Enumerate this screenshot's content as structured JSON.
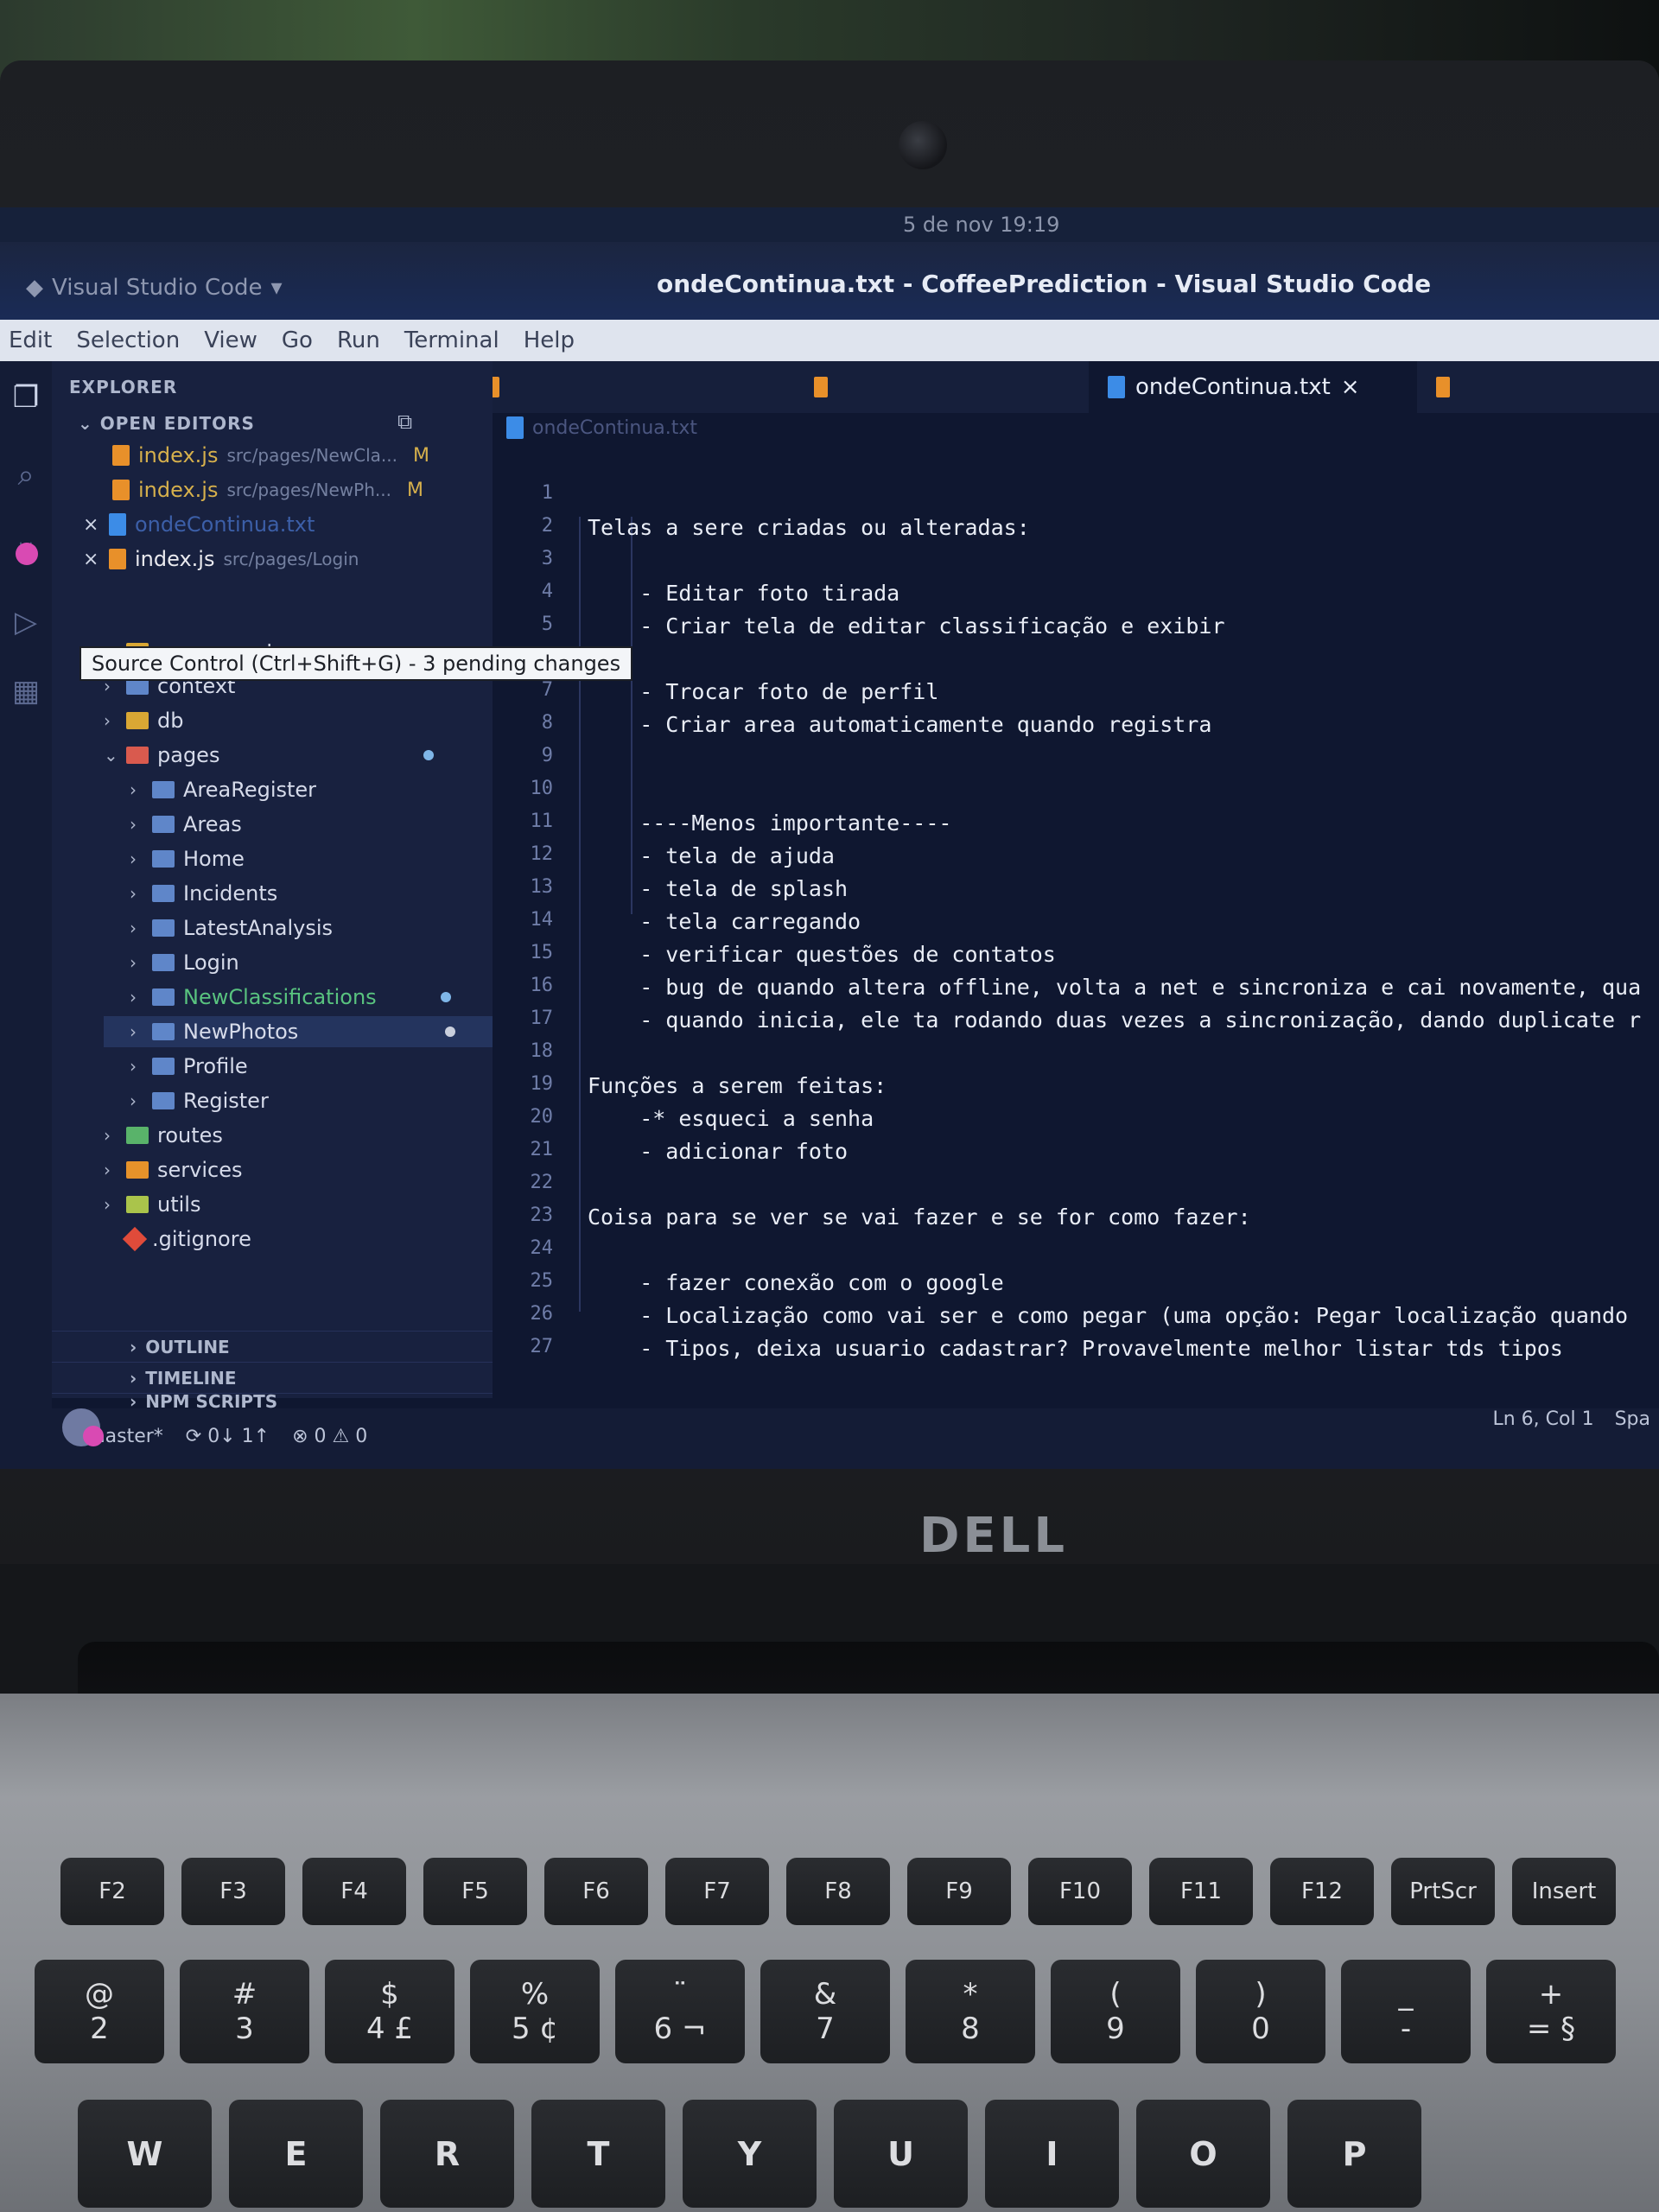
{
  "system": {
    "clock": "5 de nov  19:19"
  },
  "window": {
    "app_menu": "Visual Studio Code",
    "title": "ondeContinua.txt - CoffeePrediction - Visual Studio Code"
  },
  "menu": [
    "Edit",
    "Selection",
    "View",
    "Go",
    "Run",
    "Terminal",
    "Help"
  ],
  "tabs": [
    {
      "label": "ondeContinua.txt",
      "close": "×"
    }
  ],
  "breadcrumb": "ondeContinua.txt",
  "explorer": {
    "title": "EXPLORER",
    "open_editors_title": "OPEN EDITORS",
    "open_editors": [
      {
        "name": "index.js",
        "path": "src/pages/NewCla...",
        "status": "M"
      },
      {
        "name": "index.js",
        "path": "src/pages/NewPh...",
        "status": "M"
      },
      {
        "name": "ondeContinua.txt",
        "path": "",
        "status": ""
      },
      {
        "name": "index.js",
        "path": "src/pages/Login",
        "status": ""
      }
    ],
    "tooltip": "Source Control (Ctrl+Shift+G) - 3 pending changes",
    "tree": [
      {
        "label": "components",
        "depth": 1,
        "color": "yellow"
      },
      {
        "label": "context",
        "depth": 1,
        "color": "blue"
      },
      {
        "label": "db",
        "depth": 1,
        "color": "yellow"
      },
      {
        "label": "pages",
        "depth": 1,
        "color": "red",
        "open": true
      },
      {
        "label": "AreaRegister",
        "depth": 2,
        "color": "blue"
      },
      {
        "label": "Areas",
        "depth": 2,
        "color": "blue"
      },
      {
        "label": "Home",
        "depth": 2,
        "color": "blue"
      },
      {
        "label": "Incidents",
        "depth": 2,
        "color": "blue"
      },
      {
        "label": "LatestAnalysis",
        "depth": 2,
        "color": "blue"
      },
      {
        "label": "Login",
        "depth": 2,
        "color": "blue"
      },
      {
        "label": "NewClassifications",
        "depth": 2,
        "color": "blue",
        "modified": true
      },
      {
        "label": "NewPhotos",
        "depth": 2,
        "color": "blue",
        "selected": true
      },
      {
        "label": "Profile",
        "depth": 2,
        "color": "blue"
      },
      {
        "label": "Register",
        "depth": 2,
        "color": "blue"
      },
      {
        "label": "routes",
        "depth": 1,
        "color": "green"
      },
      {
        "label": "services",
        "depth": 1,
        "color": "orange"
      },
      {
        "label": "utils",
        "depth": 1,
        "color": "lime"
      },
      {
        "label": ".gitignore",
        "depth": 1,
        "color": "git"
      }
    ],
    "panels": [
      "OUTLINE",
      "TIMELINE",
      "NPM SCRIPTS"
    ]
  },
  "editor": {
    "lines": [
      {
        "n": "1",
        "text": ""
      },
      {
        "n": "2",
        "text": "Telas a sere criadas ou alteradas:"
      },
      {
        "n": "3",
        "text": ""
      },
      {
        "n": "4",
        "text": "    - Editar foto tirada"
      },
      {
        "n": "5",
        "text": "    - Criar tela de editar classificação e exibir"
      },
      {
        "n": "6",
        "text": ""
      },
      {
        "n": "7",
        "text": "    - Trocar foto de perfil"
      },
      {
        "n": "8",
        "text": "    - Criar area automaticamente quando registra"
      },
      {
        "n": "9",
        "text": ""
      },
      {
        "n": "10",
        "text": ""
      },
      {
        "n": "11",
        "text": "    ----Menos importante----"
      },
      {
        "n": "12",
        "text": "    - tela de ajuda"
      },
      {
        "n": "13",
        "text": "    - tela de splash"
      },
      {
        "n": "14",
        "text": "    - tela carregando"
      },
      {
        "n": "15",
        "text": "    - verificar questões de contatos"
      },
      {
        "n": "16",
        "text": "    - bug de quando altera offline, volta a net e sincroniza e cai novamente, qua"
      },
      {
        "n": "17",
        "text": "    - quando inicia, ele ta rodando duas vezes a sincronização, dando duplicate r"
      },
      {
        "n": "18",
        "text": ""
      },
      {
        "n": "19",
        "text": "Funções a serem feitas:"
      },
      {
        "n": "20",
        "text": "    -* esqueci a senha"
      },
      {
        "n": "21",
        "text": "    - adicionar foto"
      },
      {
        "n": "22",
        "text": ""
      },
      {
        "n": "23",
        "text": "Coisa para se ver se vai fazer e se for como fazer:"
      },
      {
        "n": "24",
        "text": ""
      },
      {
        "n": "25",
        "text": "    - fazer conexão com o google"
      },
      {
        "n": "26",
        "text": "    - Localização como vai ser e como pegar (uma opção: Pegar localização quando"
      },
      {
        "n": "27",
        "text": "    - Tipos, deixa usuario cadastrar? Provavelmente melhor listar tds tipos"
      }
    ]
  },
  "status": {
    "branch": "master*",
    "sync": "0↓ 1↑",
    "problems": "⊗ 0 ⚠ 0",
    "position": "Ln 6, Col 1",
    "spaces": "Spa"
  },
  "laptop_brand": "DELL",
  "keys": {
    "fn_row": [
      "F2",
      "F3",
      "F4",
      "F5",
      "F6",
      "F7",
      "F8",
      "F9",
      "F10",
      "F11",
      "F12",
      "PrtScr",
      "Insert"
    ],
    "num_row": [
      {
        "top": "@",
        "bottom": "2"
      },
      {
        "top": "#",
        "bottom": "3"
      },
      {
        "top": "$",
        "bottom": "4 £"
      },
      {
        "top": "%",
        "bottom": "5 ¢"
      },
      {
        "top": "¨",
        "bottom": "6 ¬"
      },
      {
        "top": "&",
        "bottom": "7"
      },
      {
        "top": "*",
        "bottom": "8"
      },
      {
        "top": "(",
        "bottom": "9"
      },
      {
        "top": ")",
        "bottom": "0"
      },
      {
        "top": "_",
        "bottom": "-"
      },
      {
        "top": "+",
        "bottom": "= §"
      }
    ],
    "letter_row": [
      "W",
      "E",
      "R",
      "T",
      "Y",
      "U",
      "I",
      "O",
      "P"
    ]
  },
  "colors": {
    "editor_bg": "#0f1730",
    "sidebar_bg": "#18213f",
    "menu_bg": "#dfe4ee",
    "modified": "#d6b04c"
  }
}
